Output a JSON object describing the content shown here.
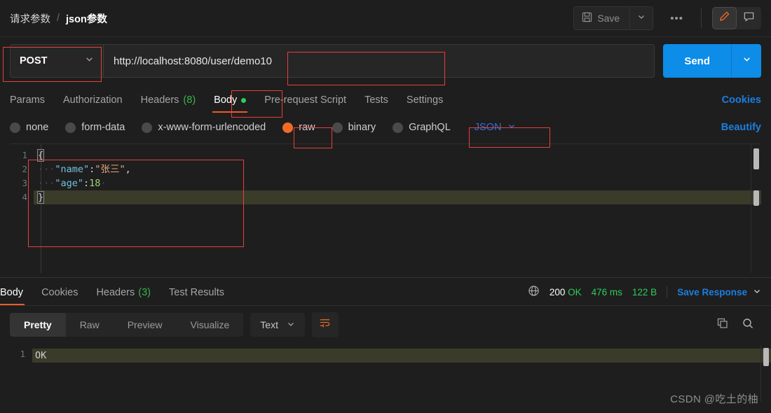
{
  "breadcrumb": {
    "parent": "请求参数",
    "separator": "/",
    "current": "json参数"
  },
  "toolbar": {
    "save_label": "Save",
    "save_icon": "floppy-disk-icon",
    "caret_icon": "chevron-down-icon",
    "more_label": "•••",
    "edit_icon": "pencil-icon",
    "comment_icon": "comment-icon"
  },
  "request": {
    "method": "POST",
    "url": "http://localhost:8080/user/demo10",
    "send_label": "Send"
  },
  "request_tabs": [
    {
      "label": "Params",
      "count": "",
      "active": false,
      "dot": false
    },
    {
      "label": "Authorization",
      "count": "",
      "active": false,
      "dot": false
    },
    {
      "label": "Headers",
      "count": "(8)",
      "active": false,
      "dot": false
    },
    {
      "label": "Body",
      "count": "",
      "active": true,
      "dot": true
    },
    {
      "label": "Pre-request Script",
      "count": "",
      "active": false,
      "dot": false
    },
    {
      "label": "Tests",
      "count": "",
      "active": false,
      "dot": false
    },
    {
      "label": "Settings",
      "count": "",
      "active": false,
      "dot": false
    }
  ],
  "cookies_link": "Cookies",
  "body_types": [
    {
      "label": "none",
      "selected": false
    },
    {
      "label": "form-data",
      "selected": false
    },
    {
      "label": "x-www-form-urlencoded",
      "selected": false
    },
    {
      "label": "raw",
      "selected": true
    },
    {
      "label": "binary",
      "selected": false
    },
    {
      "label": "GraphQL",
      "selected": false
    }
  ],
  "raw_format": "JSON",
  "beautify_link": "Beautify",
  "request_body": {
    "lines": [
      {
        "num": "1",
        "highlight": false
      },
      {
        "num": "2",
        "highlight": false
      },
      {
        "num": "3",
        "highlight": false
      },
      {
        "num": "4",
        "highlight": true
      }
    ],
    "l1_brace": "{",
    "l2_dots": "···",
    "l2_key": "\"name\"",
    "l2_colon": ":",
    "l2_value": "\"张三\"",
    "l2_comma": ",",
    "l3_dots": "···",
    "l3_key": "\"age\"",
    "l3_colon": ":",
    "l3_value": "18",
    "l3_trail": "·",
    "l4_brace": "}"
  },
  "response_tabs": [
    {
      "label": "Body",
      "count": "",
      "active": true
    },
    {
      "label": "Cookies",
      "count": "",
      "active": false
    },
    {
      "label": "Headers",
      "count": "(3)",
      "active": false
    },
    {
      "label": "Test Results",
      "count": "",
      "active": false
    }
  ],
  "response_meta": {
    "globe_icon": "globe-icon",
    "status_code": "200",
    "status_text": "OK",
    "time": "476 ms",
    "size": "122 B",
    "save_response": "Save Response"
  },
  "response_toolbar": {
    "views": [
      {
        "label": "Pretty",
        "active": true
      },
      {
        "label": "Raw",
        "active": false
      },
      {
        "label": "Preview",
        "active": false
      },
      {
        "label": "Visualize",
        "active": false
      }
    ],
    "format": "Text",
    "wrap_icon": "word-wrap-icon",
    "copy_icon": "copy-icon",
    "search_icon": "search-icon"
  },
  "response_body": {
    "line_number": "1",
    "content": "OK"
  },
  "watermark": "CSDN @吃土的柚",
  "colors": {
    "accent_orange": "#ef5b25",
    "link_blue": "#1a7fe0",
    "send_blue": "#0d8ce8",
    "status_green": "#2ecc5a",
    "annotation_red": "#e8403a",
    "background": "#1e1e1e"
  }
}
